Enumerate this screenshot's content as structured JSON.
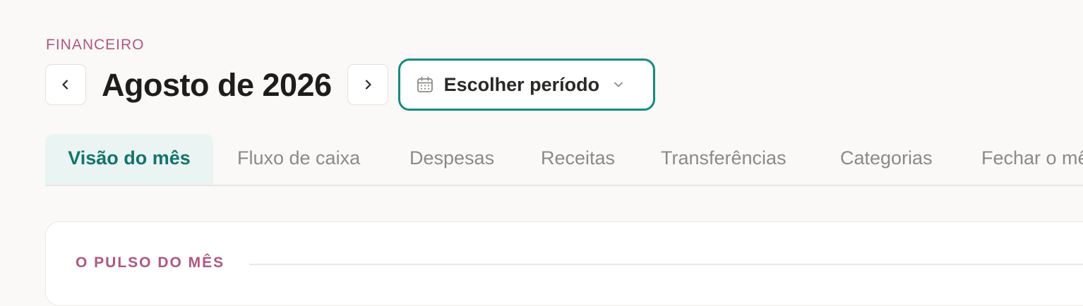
{
  "section": {
    "eyebrow": "FINANCEIRO"
  },
  "header": {
    "month_title": "Agosto de 2026",
    "prev_icon": "chevron-left-icon",
    "next_icon": "chevron-right-icon",
    "period_button": {
      "label": "Escolher período",
      "icon": "calendar-icon",
      "dropdown_icon": "chevron-down-icon"
    }
  },
  "tabs": [
    {
      "label": "Visão do mês",
      "active": true
    },
    {
      "label": "Fluxo de caixa",
      "active": false
    },
    {
      "label": "Despesas",
      "active": false
    },
    {
      "label": "Receitas",
      "active": false
    },
    {
      "label": "Transferências",
      "active": false
    },
    {
      "label": "Categorias",
      "active": false
    },
    {
      "label": "Fechar o mês",
      "active": false
    }
  ],
  "summary_card": {
    "heading": "O PULSO DO MÊS"
  },
  "colors": {
    "background": "#faf9f7",
    "accent_teal": "#168a80",
    "active_tab_bg": "#e9f4f3",
    "eyebrow_pink": "#b0577f",
    "muted_text": "#8c8a86"
  }
}
